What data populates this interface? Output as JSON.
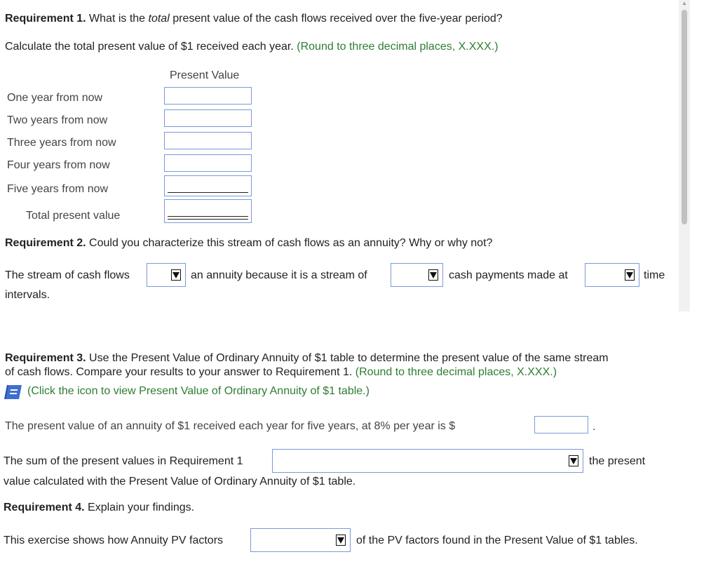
{
  "req1": {
    "heading_bold": "Requirement 1.",
    "q_part1": " What is the ",
    "q_italic": "total",
    "q_part2": " present value of the cash flows received over the five-year period?",
    "instruction": "Calculate the total present value of $1 received each year.",
    "hint": "(Round to three decimal places, X.XXX.)",
    "column_header": "Present Value",
    "rows": [
      {
        "label": "One year from now",
        "value": ""
      },
      {
        "label": "Two years from now",
        "value": ""
      },
      {
        "label": "Three years from now",
        "value": ""
      },
      {
        "label": "Four years from now",
        "value": ""
      },
      {
        "label": "Five years from now",
        "value": ""
      }
    ],
    "total_label": "Total present value",
    "total_value": ""
  },
  "req2": {
    "heading_bold": "Requirement 2.",
    "question": " Could you characterize this stream of cash flows as an annuity? Why or why not?",
    "s_part1": "The stream of cash flows",
    "s_part2": "an annuity because it is a stream of",
    "s_part3": "cash payments made at",
    "s_part4": "time",
    "s_part5": "intervals.",
    "select1": "",
    "select2": "",
    "select3": ""
  },
  "req3": {
    "heading_bold": "Requirement 3.",
    "line1": " Use the Present Value of Ordinary Annuity of $1 table to determine the present value of the same stream",
    "line2": "of cash flows. Compare your results to your answer to Requirement 1.",
    "hint": "(Round to three decimal places, X.XXX.)",
    "icon_link": "(Click the icon to view Present Value of Ordinary Annuity of $1 table.)",
    "pv_sentence": "The present value of an annuity of $1 received each year for five years, at 8% per year is $",
    "pv_value": "",
    "pv_period": ".",
    "sum_part1": "The sum of the present values in Requirement 1",
    "sum_select": "",
    "sum_part2": "the present",
    "sum_part3": "value calculated with the Present Value of Ordinary Annuity of $1 table."
  },
  "req4": {
    "heading_bold": "Requirement 4.",
    "question": " Explain your findings.",
    "s_part1": "This exercise shows how Annuity PV factors",
    "select": "",
    "s_part2": "of the PV factors found in the Present Value of $1 tables."
  },
  "colors": {
    "hint_green": "#2e7d32",
    "input_border": "#7a9ad6",
    "icon_blue": "#3f6fce"
  }
}
